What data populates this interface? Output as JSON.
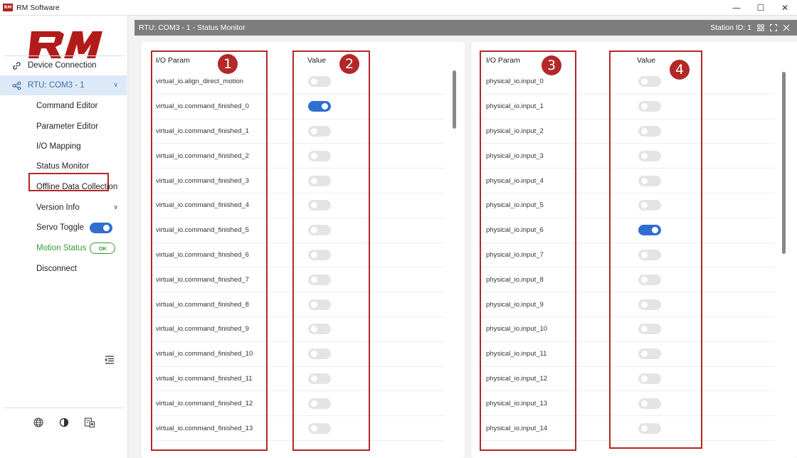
{
  "window": {
    "title": "RM Software",
    "minimize": "—",
    "maximize": "☐",
    "close": "✕"
  },
  "sidebar": {
    "logo_text": "RM",
    "items": [
      {
        "label": "Device Connection"
      },
      {
        "label": "RTU: COM3 - 1"
      },
      {
        "label": "Command Editor"
      },
      {
        "label": "Parameter Editor"
      },
      {
        "label": "I/O Mapping"
      },
      {
        "label": "Status Monitor"
      },
      {
        "label": "Offline Data Collection"
      },
      {
        "label": "Version Info"
      },
      {
        "label": "Servo Toggle"
      },
      {
        "label": "Motion Status"
      },
      {
        "label": "Disconnect"
      }
    ],
    "servo_on": true,
    "motion_badge": "OK"
  },
  "panel": {
    "title": "RTU: COM3 - 1 - Status Monitor",
    "station": "Station ID: 1"
  },
  "left_table": {
    "col_param": "I/O Param",
    "col_value": "Value",
    "rows": [
      {
        "param": "virtual_io.align_direct_motion",
        "on": false
      },
      {
        "param": "virtual_io.command_finished_0",
        "on": true
      },
      {
        "param": "virtual_io.command_finished_1",
        "on": false
      },
      {
        "param": "virtual_io.command_finished_2",
        "on": false
      },
      {
        "param": "virtual_io.command_finished_3",
        "on": false
      },
      {
        "param": "virtual_io.command_finished_4",
        "on": false
      },
      {
        "param": "virtual_io.command_finished_5",
        "on": false
      },
      {
        "param": "virtual_io.command_finished_6",
        "on": false
      },
      {
        "param": "virtual_io.command_finished_7",
        "on": false
      },
      {
        "param": "virtual_io.command_finished_8",
        "on": false
      },
      {
        "param": "virtual_io.command_finished_9",
        "on": false
      },
      {
        "param": "virtual_io.command_finished_10",
        "on": false
      },
      {
        "param": "virtual_io.command_finished_11",
        "on": false
      },
      {
        "param": "virtual_io.command_finished_12",
        "on": false
      },
      {
        "param": "virtual_io.command_finished_13",
        "on": false
      }
    ]
  },
  "right_table": {
    "col_param": "I/O Param",
    "col_value": "Value",
    "rows": [
      {
        "param": "physical_io.input_0",
        "on": false
      },
      {
        "param": "physical_io.input_1",
        "on": false
      },
      {
        "param": "physical_io.input_2",
        "on": false
      },
      {
        "param": "physical_io.input_3",
        "on": false
      },
      {
        "param": "physical_io.input_4",
        "on": false
      },
      {
        "param": "physical_io.input_5",
        "on": false
      },
      {
        "param": "physical_io.input_6",
        "on": true
      },
      {
        "param": "physical_io.input_7",
        "on": false
      },
      {
        "param": "physical_io.input_8",
        "on": false
      },
      {
        "param": "physical_io.input_9",
        "on": false
      },
      {
        "param": "physical_io.input_10",
        "on": false
      },
      {
        "param": "physical_io.input_11",
        "on": false
      },
      {
        "param": "physical_io.input_12",
        "on": false
      },
      {
        "param": "physical_io.input_13",
        "on": false
      },
      {
        "param": "physical_io.input_14",
        "on": false
      }
    ]
  },
  "markers": [
    "1",
    "2",
    "3",
    "4"
  ],
  "colors": {
    "accent": "#2f6fd0",
    "annotation": "#b32828",
    "brand": "#b31b1b",
    "ok": "#3a9a3a"
  }
}
